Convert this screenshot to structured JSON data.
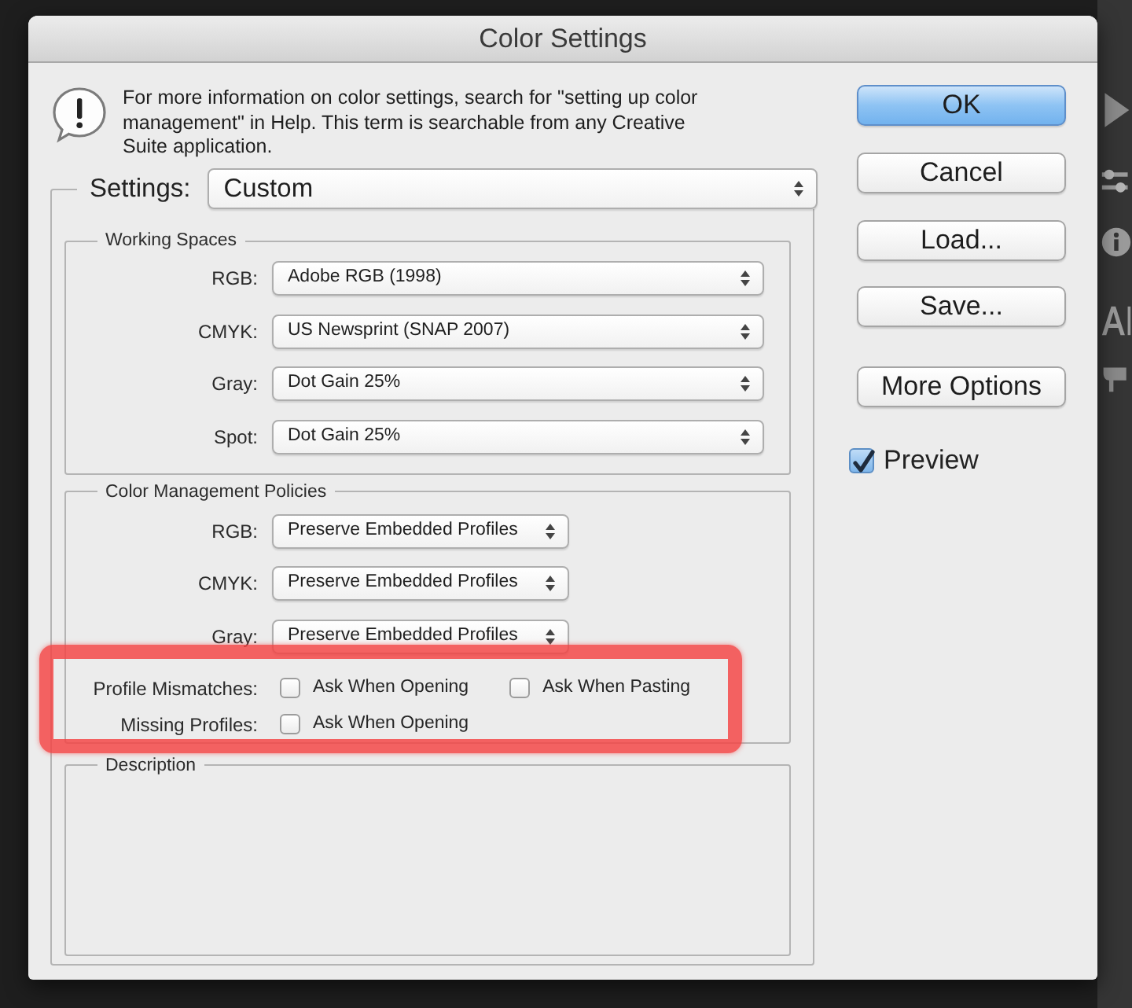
{
  "window": {
    "title": "Color Settings"
  },
  "message": {
    "text": "For more information on color settings, search for \"setting up color management\" in Help. This term is searchable from any Creative Suite application."
  },
  "settings": {
    "label": "Settings:",
    "value": "Custom"
  },
  "working_spaces": {
    "title": "Working Spaces",
    "rows": [
      {
        "label": "RGB:",
        "value": "Adobe RGB (1998)"
      },
      {
        "label": "CMYK:",
        "value": "US Newsprint (SNAP 2007)"
      },
      {
        "label": "Gray:",
        "value": "Dot Gain 25%"
      },
      {
        "label": "Spot:",
        "value": "Dot Gain 25%"
      }
    ]
  },
  "color_management_policies": {
    "title": "Color Management Policies",
    "rows": [
      {
        "label": "RGB:",
        "value": "Preserve Embedded Profiles"
      },
      {
        "label": "CMYK:",
        "value": "Preserve Embedded Profiles"
      },
      {
        "label": "Gray:",
        "value": "Preserve Embedded Profiles"
      }
    ],
    "checkbox_rows": [
      {
        "label": "Profile Mismatches:",
        "checkboxes": [
          {
            "label": "Ask When Opening",
            "checked": false
          },
          {
            "label": "Ask When Pasting",
            "checked": false
          }
        ]
      },
      {
        "label": "Missing Profiles:",
        "checkboxes": [
          {
            "label": "Ask When Opening",
            "checked": false
          }
        ]
      }
    ]
  },
  "description": {
    "title": "Description"
  },
  "buttons": [
    {
      "label": "OK",
      "default": true
    },
    {
      "label": "Cancel",
      "default": false
    },
    {
      "label": "Load...",
      "default": false
    },
    {
      "label": "Save...",
      "default": false
    },
    {
      "label": "More Options",
      "default": false
    }
  ],
  "preview": {
    "label": "Preview",
    "checked": true
  }
}
